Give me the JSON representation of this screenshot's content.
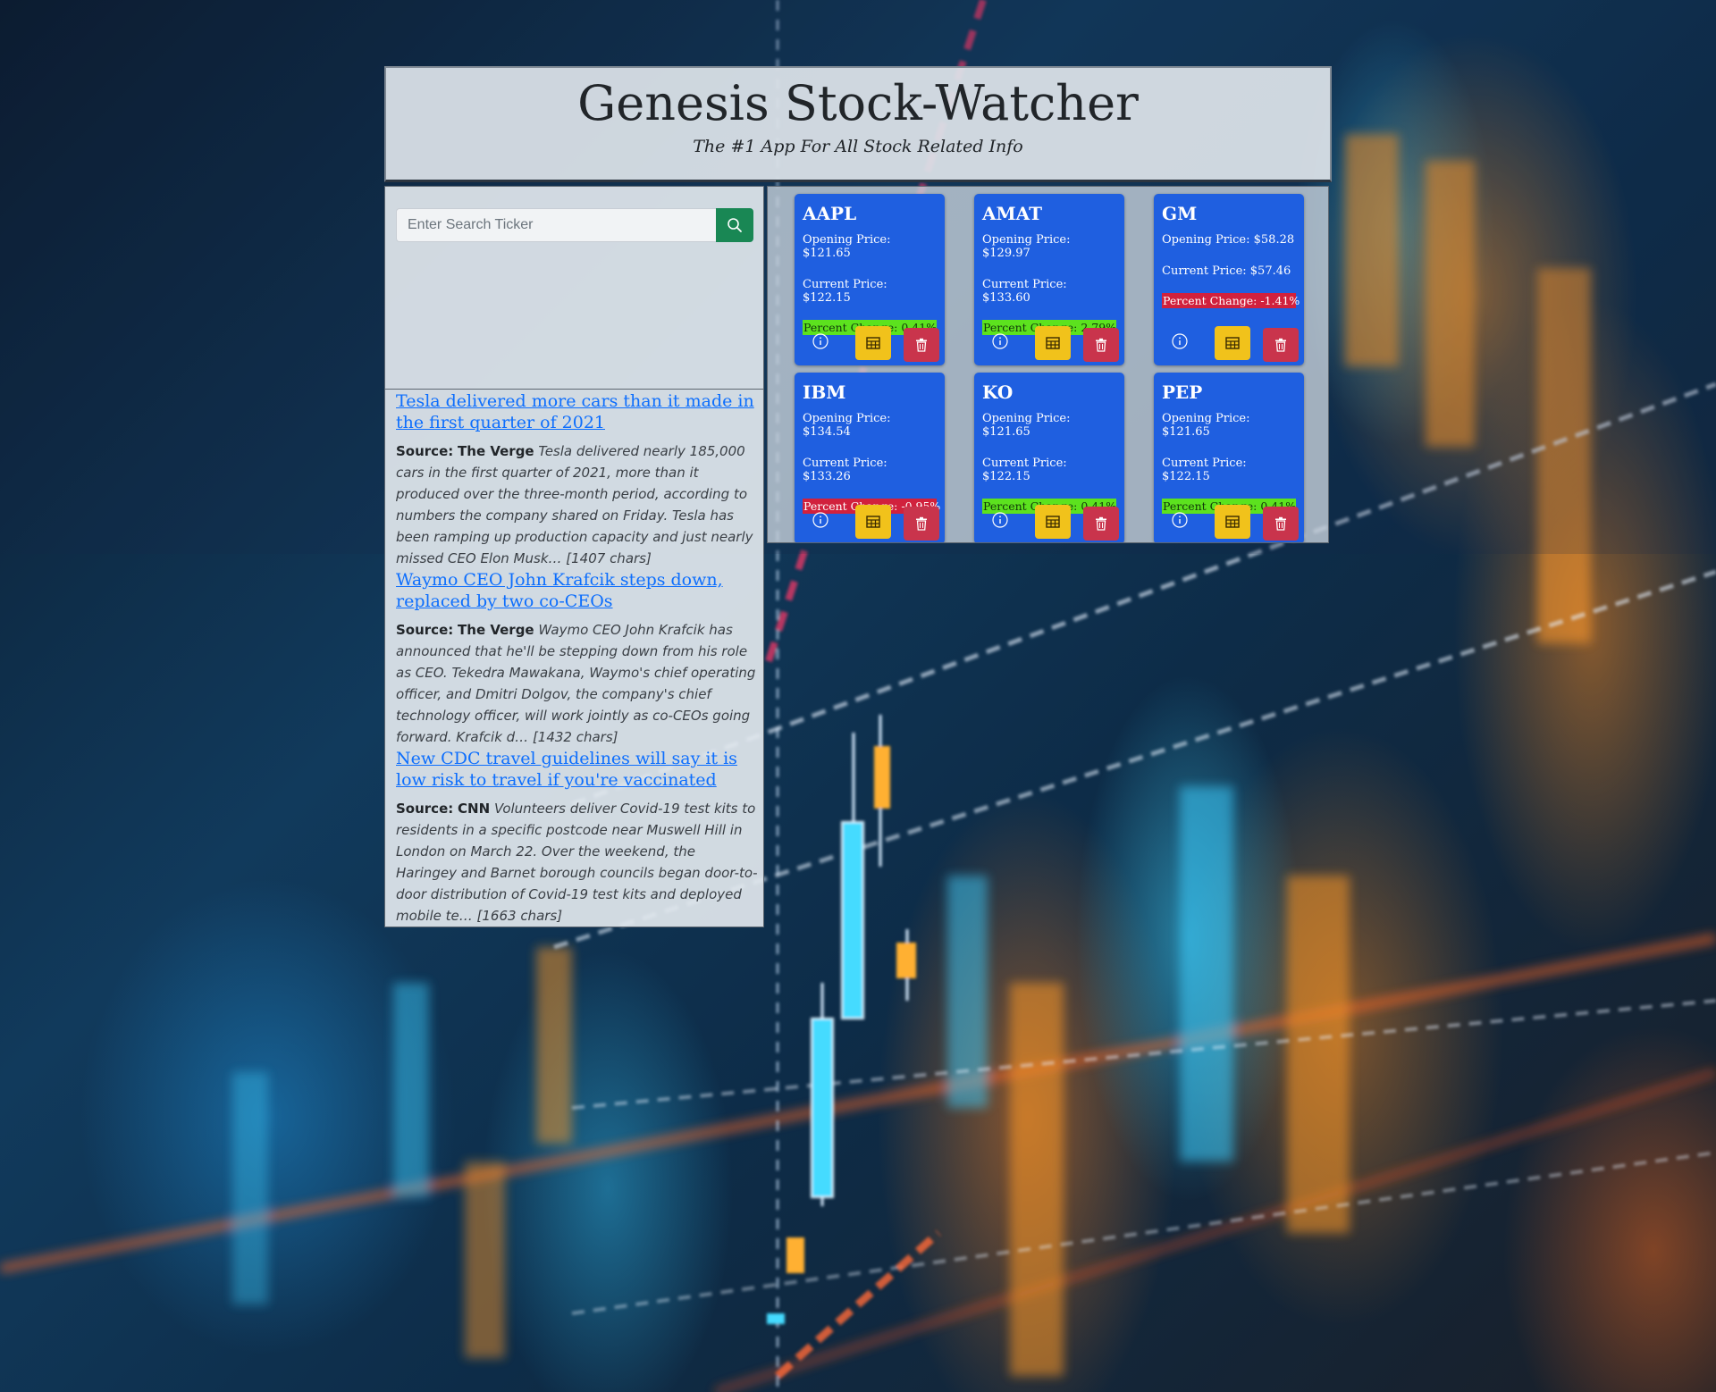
{
  "header": {
    "title": "Genesis Stock-Watcher",
    "subtitle": "The #1 App For All Stock Related Info"
  },
  "search": {
    "placeholder": "Enter Search Ticker",
    "button_icon": "search-icon"
  },
  "news": [
    {
      "headline": "Tesla delivered more cars than it made in the first quarter of 2021",
      "source_label": "Source:",
      "source": "The Verge",
      "description": "Tesla delivered nearly 185,000 cars in the first quarter of 2021, more than it produced over the three-month period, according to numbers the company shared on Friday. Tesla has been ramping up production capacity and just nearly missed CEO Elon Musk… [1407 chars]"
    },
    {
      "headline": "Waymo CEO John Krafcik steps down, replaced by two co-CEOs",
      "source_label": "Source:",
      "source": "The Verge",
      "description": "Waymo CEO John Krafcik has announced that he'll be stepping down from his role as CEO. Tekedra Mawakana, Waymo's chief operating officer, and Dmitri Dolgov, the company's chief technology officer, will work jointly as co-CEOs going forward. Krafcik d… [1432 chars]"
    },
    {
      "headline": "New CDC travel guidelines will say it is low risk to travel if you're vaccinated",
      "source_label": "Source:",
      "source": "CNN",
      "description": "Volunteers deliver Covid-19 test kits to residents in a specific postcode near Muswell Hill in London on March 22. Over the weekend, the Haringey and Barnet borough councils began door-to-door distribution of Covid-19 test kits and deployed mobile te… [1663 chars]"
    }
  ],
  "stocks": [
    {
      "ticker": "AAPL",
      "opening": "Opening Price: $121.65",
      "current": "Current Price: $122.15",
      "change": "Percent Change: 0.41%",
      "direction": "up"
    },
    {
      "ticker": "AMAT",
      "opening": "Opening Price: $129.97",
      "current": "Current Price: $133.60",
      "change": "Percent Change: 2.79%",
      "direction": "up"
    },
    {
      "ticker": "GM",
      "opening": "Opening Price: $58.28",
      "current": "Current Price: $57.46",
      "change": "Percent Change: -1.41%",
      "direction": "down"
    },
    {
      "ticker": "IBM",
      "opening": "Opening Price: $134.54",
      "current": "Current Price: $133.26",
      "change": "Percent Change: -0.95%",
      "direction": "down"
    },
    {
      "ticker": "KO",
      "opening": "Opening Price: $121.65",
      "current": "Current Price: $122.15",
      "change": "Percent Change: 0.41%",
      "direction": "up"
    },
    {
      "ticker": "PEP",
      "opening": "Opening Price: $121.65",
      "current": "Current Price: $122.15",
      "change": "Percent Change: 0.41%",
      "direction": "up"
    }
  ],
  "card_icons": {
    "info": "info-icon",
    "chart": "chart-icon",
    "delete": "trash-icon"
  },
  "colors": {
    "card_bg": "#1f5fe0",
    "positive": "#5ce21e",
    "negative": "#d1213d",
    "search_button": "#198754",
    "chart_button": "#f1c21b",
    "delete_button": "#c9344c",
    "link": "#0d6efd"
  }
}
